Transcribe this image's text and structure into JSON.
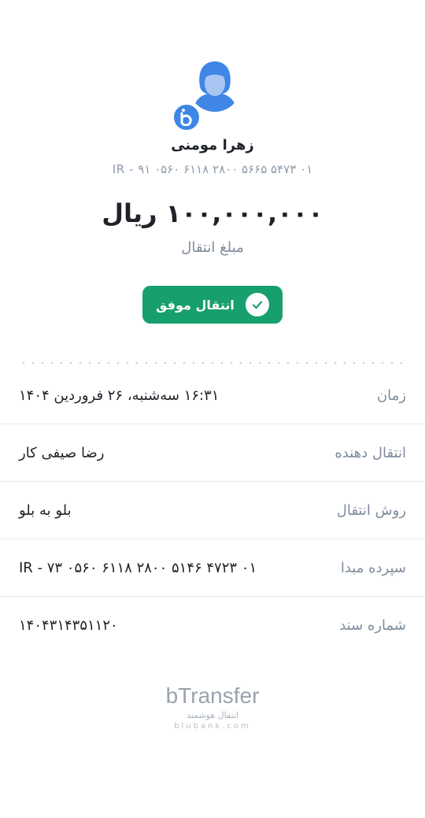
{
  "recipient": {
    "name": "زهرا مومنی",
    "iban": "IR - ۹۱ ۰۵۶۰ ۶۱۱۸ ۲۸۰۰ ۵۶۶۵ ۵۴۷۳ ۰۱"
  },
  "transfer": {
    "amount": "۱۰۰,۰۰۰,۰۰۰ ریال",
    "amount_label": "مبلغ انتقال",
    "status": "انتقال موفق"
  },
  "details": [
    {
      "label": "زمان",
      "value": "۱۶:۳۱ سه‌شنبه، ۲۶ فروردین ۱۴۰۴"
    },
    {
      "label": "انتقال دهنده",
      "value": "رضا صیفی کار"
    },
    {
      "label": "روش انتقال",
      "value": "بلو به بلو"
    },
    {
      "label": "سپرده مبدا",
      "value": "IR - ۷۳ ۰۵۶۰ ۶۱۱۸ ۲۸۰۰ ۵۱۴۶ ۴۷۲۳ ۰۱"
    },
    {
      "label": "شماره سند",
      "value": "۱۴۰۴۳۱۴۳۵۱۱۲۰"
    }
  ],
  "branding": {
    "logo_text": "bTransfer",
    "logo_subtitle": "انتقال هوشمند",
    "url": "blubank.com"
  },
  "colors": {
    "accent": "#3f86e6",
    "success": "#17a06d"
  }
}
